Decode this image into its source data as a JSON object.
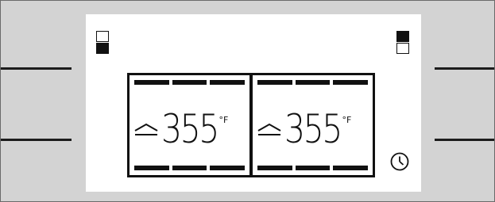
{
  "ovens": [
    {
      "temperature": "355",
      "unit": "°F",
      "indicator_icon": "oven-position-bottom-icon"
    },
    {
      "temperature": "355",
      "unit": "°F",
      "indicator_icon": "oven-position-top-icon"
    }
  ],
  "icons": {
    "left_indicator": "oven-position-bottom-icon",
    "right_indicator": "oven-position-top-icon",
    "heat_mode": "bake-heat-icon",
    "timer": "clock-icon"
  },
  "colors": {
    "panel_background": "#d3d3d3",
    "screen_background": "#ffffff",
    "segment_color": "#111111"
  }
}
